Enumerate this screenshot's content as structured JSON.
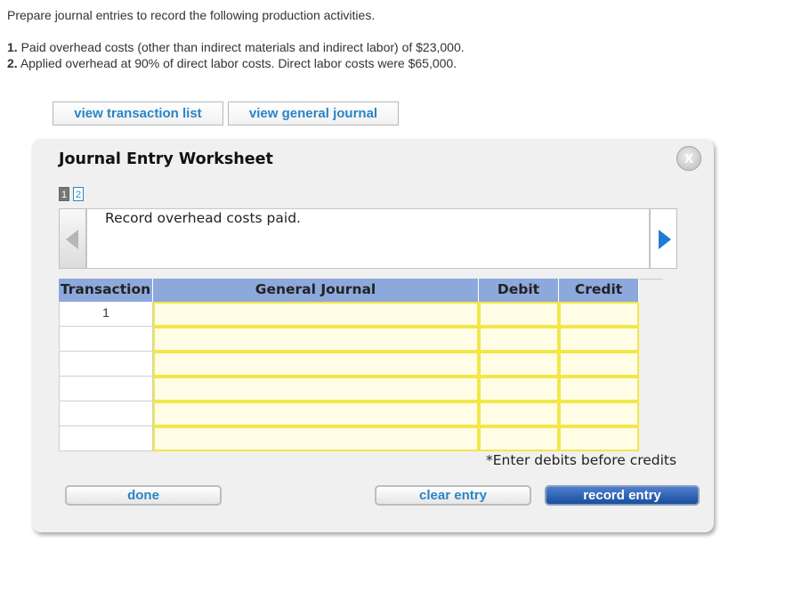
{
  "instructions": "Prepare journal entries to record the following production activities.",
  "requirements": [
    {
      "num": "1.",
      "text": "Paid overhead costs (other than indirect materials and indirect labor) of $23,000."
    },
    {
      "num": "2.",
      "text": "Applied overhead at 90% of direct labor costs. Direct labor costs were $65,000."
    }
  ],
  "top_buttons": {
    "transaction_list": "view transaction list",
    "general_journal": "view general journal"
  },
  "worksheet": {
    "title": "Journal Entry Worksheet",
    "close_label": "X",
    "pages": [
      "1",
      "2"
    ],
    "current_page": "1",
    "description": "Record overhead costs paid.",
    "columns": {
      "transaction": "Transaction",
      "general_journal": "General Journal",
      "debit": "Debit",
      "credit": "Credit"
    },
    "rows": [
      {
        "transaction": "1",
        "account": "",
        "debit": "",
        "credit": ""
      },
      {
        "transaction": "",
        "account": "",
        "debit": "",
        "credit": ""
      },
      {
        "transaction": "",
        "account": "",
        "debit": "",
        "credit": ""
      },
      {
        "transaction": "",
        "account": "",
        "debit": "",
        "credit": ""
      },
      {
        "transaction": "",
        "account": "",
        "debit": "",
        "credit": ""
      },
      {
        "transaction": "",
        "account": "",
        "debit": "",
        "credit": ""
      }
    ],
    "note": "*Enter debits before credits",
    "buttons": {
      "done": "done",
      "clear": "clear entry",
      "record": "record entry"
    }
  },
  "colors": {
    "link_blue": "#2a84c6",
    "header_blue": "#8da9dc",
    "cell_border_yellow": "#f3e64a",
    "record_button": "#184e9c"
  },
  "icons": {
    "close": "close-icon",
    "prev": "left-arrow-icon",
    "next": "right-arrow-icon"
  }
}
